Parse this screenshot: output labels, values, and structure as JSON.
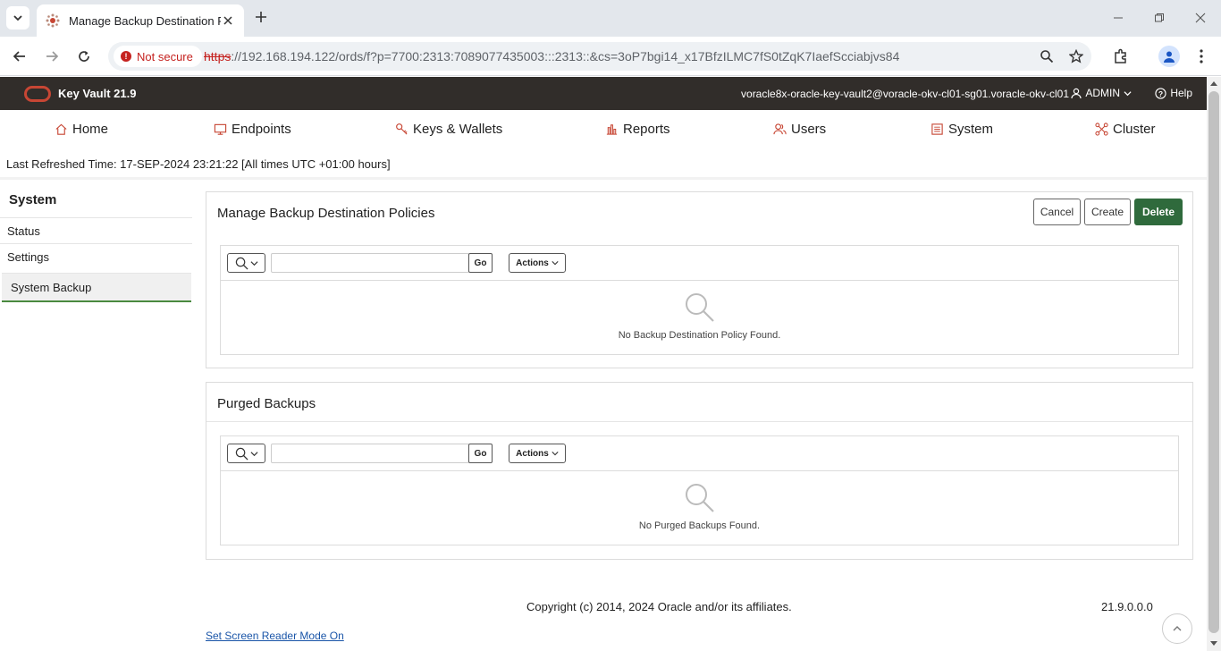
{
  "browser": {
    "tab_title": "Manage Backup Destination Po",
    "security_label": "Not secure",
    "url_protocol": "https",
    "url_rest": "://192.168.194.122/ords/f?p=7700:2313:7089077435003:::2313::&cs=3oP7bgi14_x17BfzILMC7fS0tZqK7IaefScciabjvs84"
  },
  "header": {
    "app_name": "Key Vault 21.9",
    "user_context": "voracle8x-oracle-key-vault2@voracle-okv-cl01-sg01.voracle-okv-cl01",
    "user_menu": "ADMIN",
    "help": "Help",
    "brand_color": "#c74634"
  },
  "nav": {
    "items": [
      {
        "label": "Home",
        "icon": "home-icon"
      },
      {
        "label": "Endpoints",
        "icon": "monitor-icon"
      },
      {
        "label": "Keys & Wallets",
        "icon": "key-icon"
      },
      {
        "label": "Reports",
        "icon": "bar-chart-icon"
      },
      {
        "label": "Users",
        "icon": "users-icon"
      },
      {
        "label": "System",
        "icon": "system-icon"
      },
      {
        "label": "Cluster",
        "icon": "cluster-icon"
      }
    ]
  },
  "refresh_text": "Last Refreshed Time: 17-SEP-2024 23:21:22 [All times UTC +01:00 hours]",
  "sidebar": {
    "title": "System",
    "items": [
      {
        "label": "Status"
      },
      {
        "label": "Settings"
      },
      {
        "label": "System Backup"
      }
    ]
  },
  "policies_panel": {
    "title": "Manage Backup Destination Policies",
    "cancel": "Cancel",
    "create": "Create",
    "delete": "Delete",
    "go": "Go",
    "actions": "Actions",
    "search_value": "",
    "empty_message": "No Backup Destination Policy Found."
  },
  "purged_panel": {
    "title": "Purged Backups",
    "go": "Go",
    "actions": "Actions",
    "search_value": "",
    "empty_message": "No Purged Backups Found."
  },
  "footer": {
    "copyright": "Copyright (c) 2014, 2024 Oracle and/or its affiliates.",
    "version": "21.9.0.0.0",
    "screen_reader": "Set Screen Reader Mode On"
  },
  "colors": {
    "header_bg": "#312d2a",
    "primary_button": "#2f6a3c",
    "active_underline": "#4a8a3f"
  }
}
